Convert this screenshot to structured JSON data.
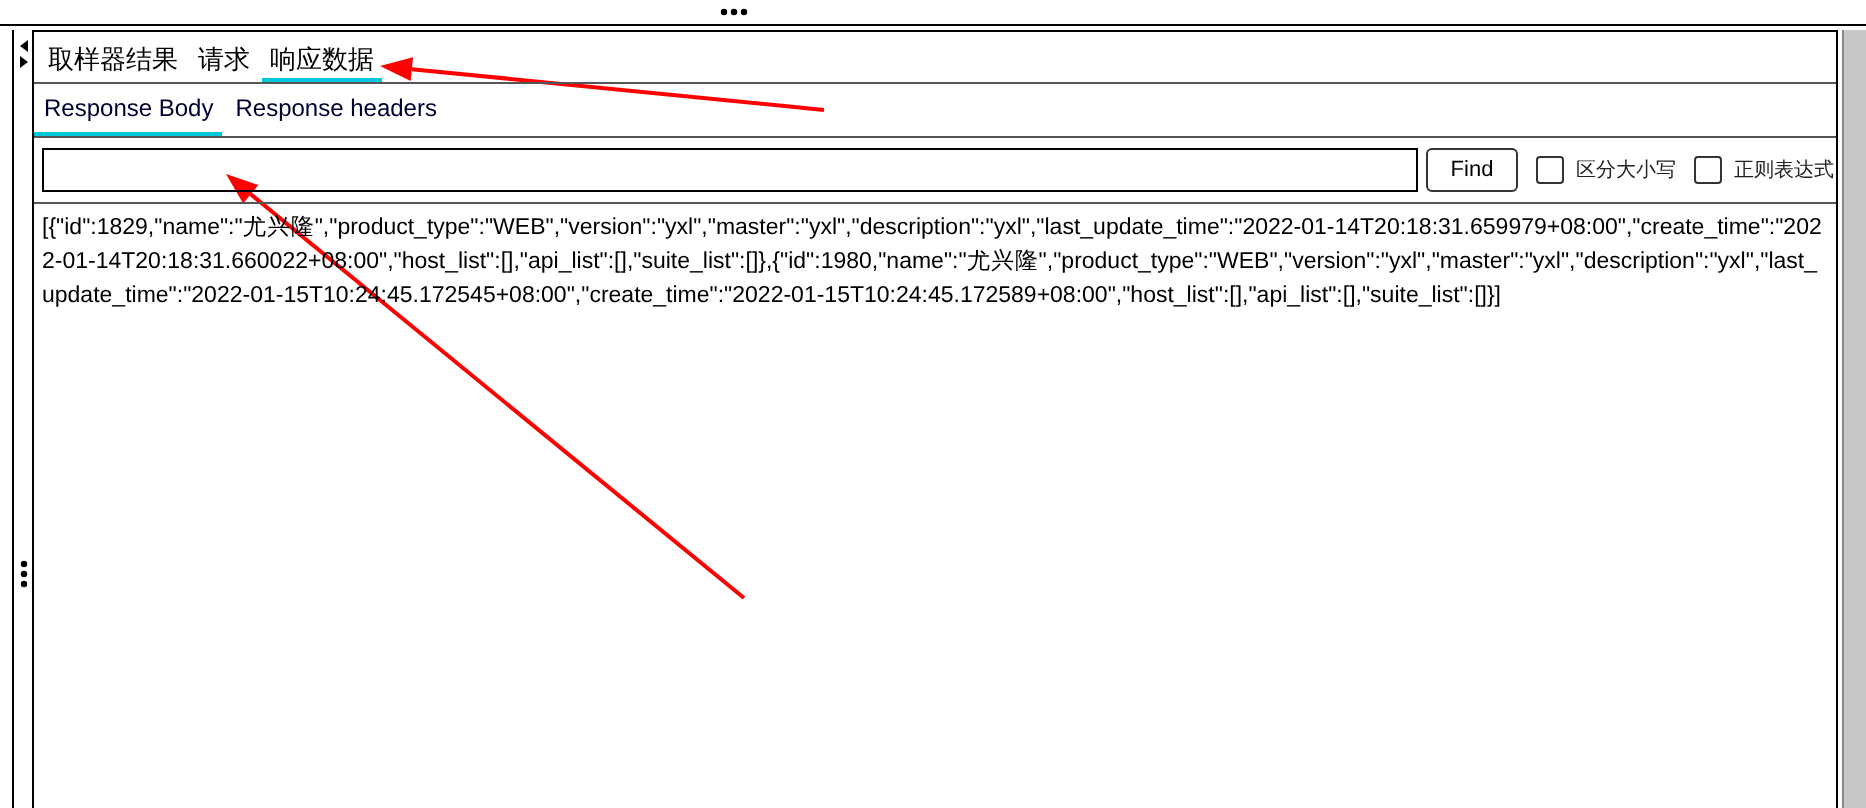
{
  "tabs": [
    {
      "label": "取样器结果",
      "selected": false
    },
    {
      "label": "请求",
      "selected": false
    },
    {
      "label": "响应数据",
      "selected": true
    }
  ],
  "sub_tabs": [
    {
      "label": "Response Body",
      "selected": true
    },
    {
      "label": "Response headers",
      "selected": false
    }
  ],
  "search": {
    "button": "Find",
    "options": [
      {
        "label": "区分大小写",
        "checked": false
      },
      {
        "label": "正则表达式",
        "checked": false
      }
    ]
  },
  "body": "[{\"id\":1829,\"name\":\"尤兴隆\",\"product_type\":\"WEB\",\"version\":\"yxl\",\"master\":\"yxl\",\"description\":\"yxl\",\"last_update_time\":\"2022-01-14T20:18:31.659979+08:00\",\"create_time\":\"2022-01-14T20:18:31.660022+08:00\",\"host_list\":[],\"api_list\":[],\"suite_list\":[]},{\"id\":1980,\"name\":\"尤兴隆\",\"product_type\":\"WEB\",\"version\":\"yxl\",\"master\":\"yxl\",\"description\":\"yxl\",\"last_update_time\":\"2022-01-15T10:24:45.172545+08:00\",\"create_time\":\"2022-01-15T10:24:45.172589+08:00\",\"host_list\":[],\"api_list\":[],\"suite_list\":[]}]",
  "annotations": [
    {
      "kind": "arrow"
    },
    {
      "kind": "arrow"
    }
  ]
}
